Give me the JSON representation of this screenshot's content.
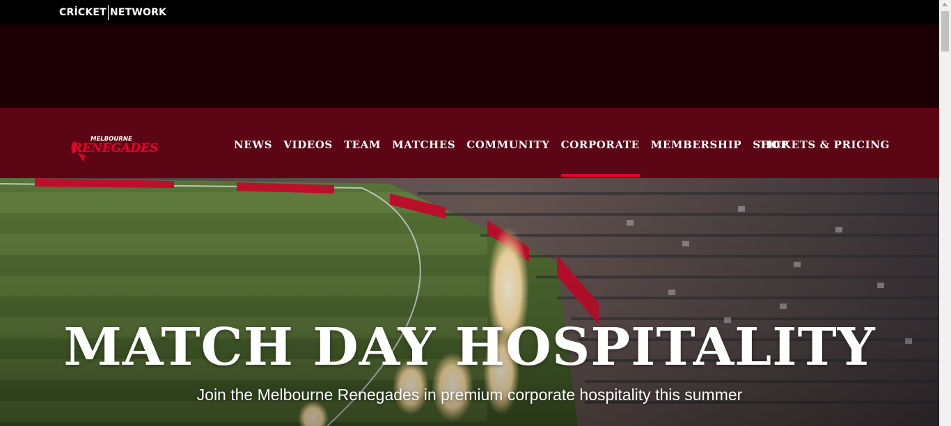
{
  "network_bar": {
    "logo_left": "CRİCKET",
    "logo_right": "NETWORK"
  },
  "brand": {
    "line1": "MELBOURNE",
    "line2": "RENEGADES"
  },
  "nav": {
    "items": [
      {
        "label": "NEWS"
      },
      {
        "label": "VIDEOS"
      },
      {
        "label": "TEAM"
      },
      {
        "label": "MATCHES"
      },
      {
        "label": "COMMUNITY"
      },
      {
        "label": "CORPORATE",
        "active": true
      },
      {
        "label": "MEMBERSHIP"
      },
      {
        "label": "SHOP"
      }
    ],
    "tickets_label": "TICKETS & PRICING"
  },
  "hero": {
    "title": "MATCH DAY HOSPITALITY",
    "subtitle": "Join the Melbourne Renegades in premium corporate hospitality this summer"
  },
  "colors": {
    "nav_bg": "#5c0514",
    "ad_bg": "#1a0004",
    "accent": "#e4002b"
  }
}
